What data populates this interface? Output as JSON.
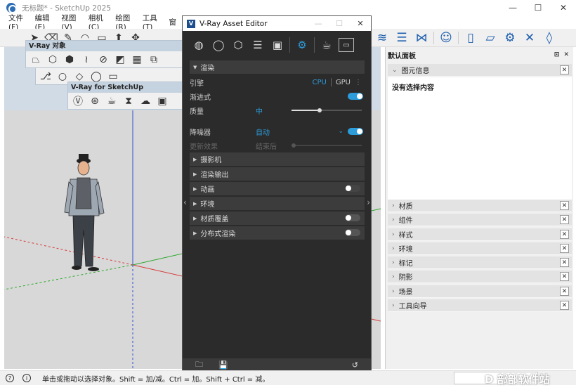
{
  "window": {
    "title": "无标题* - SketchUp 2025",
    "controls": [
      "—",
      "☐",
      "✕"
    ]
  },
  "menu": [
    "文件(F)",
    "编辑(E)",
    "视图(V)",
    "相机(C)",
    "绘图(R)",
    "工具(T)",
    "窗"
  ],
  "toolbar": {
    "left_icons": [
      "select-arrow",
      "eraser",
      "pencil",
      "arc",
      "rectangle",
      "push-pull",
      "move"
    ],
    "right_icons": [
      "vray-lights",
      "vray-layers",
      "vray-geometry",
      "user",
      "file",
      "folder",
      "settings",
      "close",
      "water-drop"
    ]
  },
  "floating_toolbars": {
    "vray_objects_title": "V-Ray 对象",
    "vray_sketchup_title": "V-Ray for SketchUp"
  },
  "vray_editor": {
    "title": "V-Ray Asset Editor",
    "logo": "V",
    "tabs": [
      "materials",
      "lights",
      "geometry",
      "layers",
      "textures",
      "settings",
      "render",
      "frame-buffer"
    ],
    "render_section": "渲染",
    "engine_label": "引擎",
    "cpu": "CPU",
    "gpu": "GPU",
    "progressive_label": "渐进式",
    "quality_label": "质量",
    "quality_value": "中",
    "quality_level": 0.5,
    "denoiser_label": "降噪器",
    "denoiser_value": "自动",
    "update_effects_label": "更新效果",
    "update_effects_value": "结束后",
    "sections": [
      "摄影机",
      "渲染输出",
      "动画",
      "环境",
      "材质覆盖",
      "分布式渲染"
    ]
  },
  "tray": {
    "title": "默认面板",
    "entity_info": "图元信息",
    "no_selection": "没有选择内容",
    "sections": [
      "材质",
      "组件",
      "样式",
      "环境",
      "标记",
      "阴影",
      "场景",
      "工具向导"
    ]
  },
  "status": {
    "text": "单击或拖动以选择对象。Shift = 加/减。Ctrl = 加。Shift + Ctrl = 减。",
    "watermark": "D 部部软件站"
  },
  "colors": {
    "vray_accent": "#2d9cdb",
    "sketchup_blue": "#1f5fae",
    "axis_red": "#d83a3a",
    "axis_green": "#2ea82e",
    "axis_blue": "#2f4fd8"
  }
}
